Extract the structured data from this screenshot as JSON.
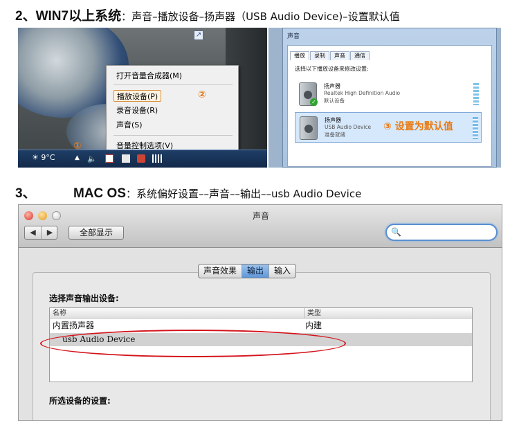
{
  "section1": {
    "heading": "2、WIN7以上系统",
    "subtitle": "：声音–播放设备–扬声器（USB Audio Device)–设置默认值",
    "context_menu": {
      "items": [
        "打开音量合成器(M)",
        "播放设备(P)",
        "录音设备(R)",
        "声音(S)",
        "音量控制选项(V)"
      ],
      "selected_index": 1
    },
    "step_markers": [
      "①",
      "②",
      "③"
    ],
    "taskbar": {
      "weather": "9°C"
    },
    "sound_dialog": {
      "title": "声音",
      "tabs": [
        "播放",
        "录制",
        "声音",
        "通信"
      ],
      "active_tab": 0,
      "instruction": "选择以下播放设备来修改设置:",
      "devices": [
        {
          "name": "扬声器",
          "line1": "Realtek High Definition Audio",
          "line2": "默认设备"
        },
        {
          "name": "扬声器",
          "line1": "USB Audio Device",
          "line2": "准备就绪"
        }
      ],
      "note": "设置为默认值"
    }
  },
  "section2": {
    "number": "3、",
    "heading": "MAC OS",
    "subtitle": "：系统偏好设置––声音––输出––usb Audio Device",
    "window": {
      "title": "声音",
      "nav_back": "◀",
      "nav_forward": "▶",
      "show_all": "全部显示",
      "search_placeholder": "",
      "tabs": [
        "声音效果",
        "输出",
        "输入"
      ],
      "active_tab": 1,
      "output_label": "选择声音输出设备:",
      "columns": [
        "名称",
        "类型"
      ],
      "rows": [
        {
          "name": "内置扬声器",
          "type": "内建"
        },
        {
          "name": "usb Audio Device",
          "type": ""
        }
      ],
      "selected_row": 1,
      "settings_label": "所选设备的设置:"
    },
    "colors": {
      "highlight_ellipse": "#d4141c",
      "tab_active": "#5e97d8"
    }
  }
}
